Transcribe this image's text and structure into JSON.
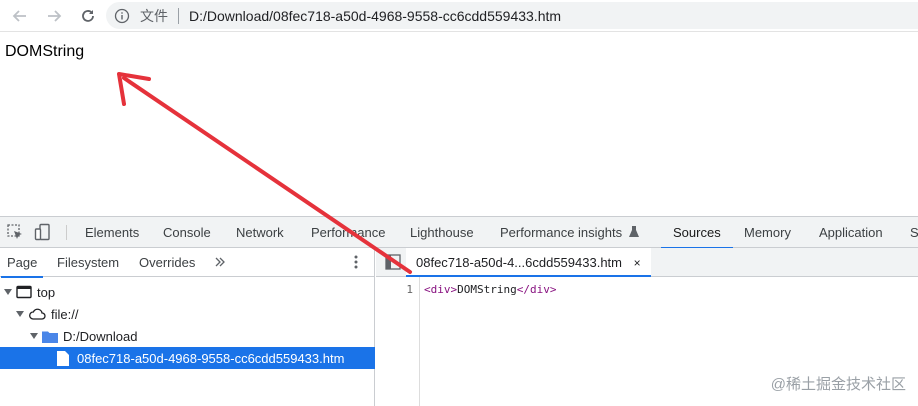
{
  "browser": {
    "scheme_label": "文件",
    "url": "D:/Download/08fec718-a50d-4968-9558-cc6cdd559433.htm"
  },
  "page": {
    "text": "DOMString"
  },
  "devtools": {
    "tabs": [
      "Elements",
      "Console",
      "Network",
      "Performance",
      "Lighthouse",
      "Performance insights",
      "Sources",
      "Memory",
      "Application",
      "S"
    ],
    "active_tab": "Sources",
    "navigator": {
      "subtabs": [
        "Page",
        "Filesystem",
        "Overrides"
      ],
      "active_subtab": "Page",
      "tree": {
        "top": "top",
        "origin": "file://",
        "folder": "D:/Download",
        "file": "08fec718-a50d-4968-9558-cc6cdd559433.htm"
      }
    },
    "editor": {
      "tab_label": "08fec718-a50d-4...6cdd559433.htm",
      "close_glyph": "×",
      "line_number": "1",
      "code_open": "<div>",
      "code_text": "DOMString",
      "code_close": "</div>"
    }
  },
  "watermark": "@稀土掘金技术社区",
  "colors": {
    "accent": "#1a73e8",
    "annotation_arrow": "#e5323b"
  },
  "icons": [
    "back-arrow-icon",
    "forward-arrow-icon",
    "reload-icon",
    "info-icon",
    "inspect-icon",
    "device-icon",
    "more-tabs-icon",
    "kebab-menu-icon",
    "flask-icon",
    "window-icon",
    "cloud-icon",
    "folder-icon",
    "file-icon",
    "toggle-sidebar-icon"
  ]
}
